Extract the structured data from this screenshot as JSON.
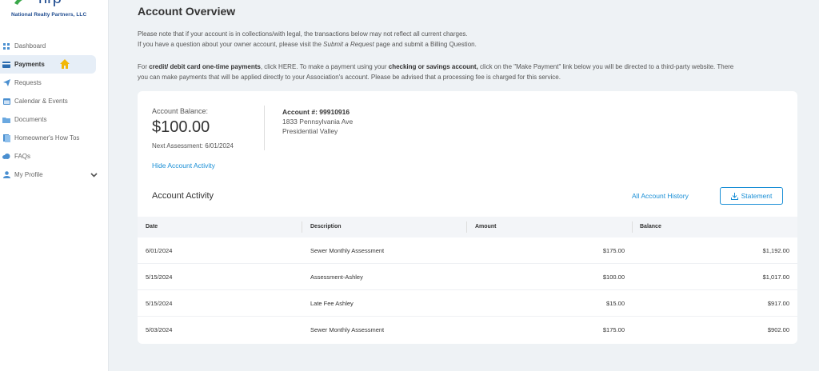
{
  "brand": {
    "name": "National Realty Partners, LLC",
    "primary": "#1e4b8f",
    "accent": "#1a8fd6",
    "green": "#3aa84a"
  },
  "sidebar": {
    "items": [
      {
        "label": "Dashboard",
        "icon": "grid-icon"
      },
      {
        "label": "Payments",
        "icon": "card-icon",
        "active": true
      },
      {
        "label": "Requests",
        "icon": "send-icon"
      },
      {
        "label": "Calendar & Events",
        "icon": "calendar-icon"
      },
      {
        "label": "Documents",
        "icon": "folder-icon"
      },
      {
        "label": "Homeowner's How Tos",
        "icon": "doc-icon"
      },
      {
        "label": "FAQs",
        "icon": "cloud-icon"
      },
      {
        "label": "My Profile",
        "icon": "user-icon"
      }
    ]
  },
  "page": {
    "title": "Account Overview",
    "notice1": "Please note that if your account is in collections/with legal, the transactions below may not reflect all current charges.",
    "notice2_a": "If you have a question about your owner account, please visit the ",
    "notice2_link": "Submit a Request",
    "notice2_b": " page and submit a Billing Question.",
    "notice3_a": "For ",
    "notice3_bold1": "credit/ debit card one-time payments",
    "notice3_b": ", click HERE. To make a payment using your ",
    "notice3_bold2": "checking or savings account,",
    "notice3_c": " click on the \"Make Payment\" link below you will be directed to a third-party website. There",
    "notice4": "you can make payments that will be applied directly to your Association's account. Please be advised that a processing fee is charged for this service."
  },
  "account": {
    "balance_label": "Account Balance:",
    "balance": "$100.00",
    "next_assessment": "Next Assessment: 6/01/2024",
    "hide_link": "Hide Account Activity",
    "number_label": "Account #: 99910916",
    "address1": "1833 Pennsylvania Ave",
    "address2": "Presidential Valley"
  },
  "activity": {
    "title": "Account Activity",
    "all_history": "All Account History",
    "statement": "Statement",
    "columns": [
      "Date",
      "Description",
      "Amount",
      "Balance"
    ],
    "rows": [
      {
        "date": "6/01/2024",
        "description": "Sewer Monthly Assessment",
        "amount": "$175.00",
        "balance": "$1,192.00"
      },
      {
        "date": "5/15/2024",
        "description": "Assessment-Ashley",
        "amount": "$100.00",
        "balance": "$1,017.00"
      },
      {
        "date": "5/15/2024",
        "description": "Late Fee Ashley",
        "amount": "$15.00",
        "balance": "$917.00"
      },
      {
        "date": "5/03/2024",
        "description": "Sewer Monthly Assessment",
        "amount": "$175.00",
        "balance": "$902.00"
      }
    ]
  }
}
